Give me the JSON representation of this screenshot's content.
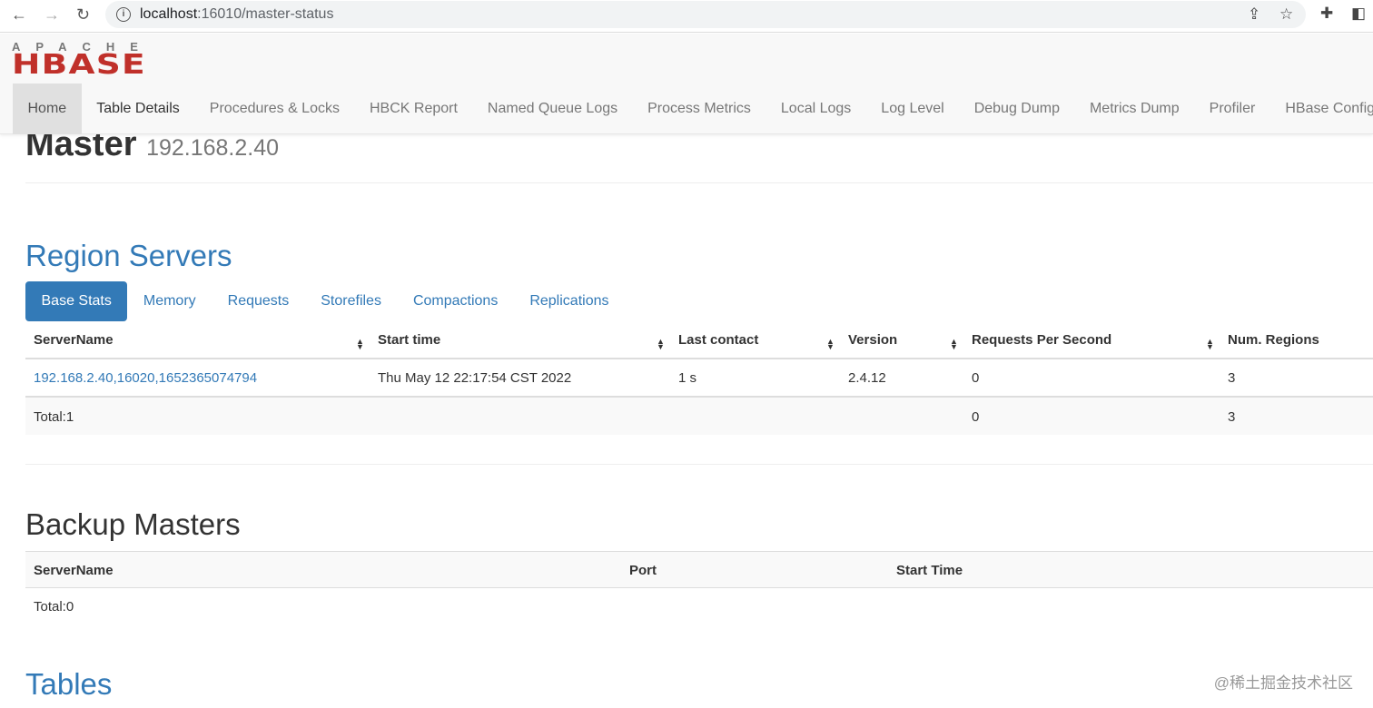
{
  "browser": {
    "url_host": "localhost",
    "url_path": ":16010/master-status"
  },
  "logo": {
    "top": "APACHE",
    "main": "HBASE"
  },
  "nav": [
    "Home",
    "Table Details",
    "Procedures & Locks",
    "HBCK Report",
    "Named Queue Logs",
    "Process Metrics",
    "Local Logs",
    "Log Level",
    "Debug Dump",
    "Metrics Dump",
    "Profiler",
    "HBase Configura"
  ],
  "master": {
    "title": "Master",
    "host": "192.168.2.40"
  },
  "region_servers": {
    "title": "Region Servers",
    "tabs": [
      "Base Stats",
      "Memory",
      "Requests",
      "Storefiles",
      "Compactions",
      "Replications"
    ],
    "columns": [
      "ServerName",
      "Start time",
      "Last contact",
      "Version",
      "Requests Per Second",
      "Num. Regions"
    ],
    "rows": [
      [
        "192.168.2.40,16020,1652365074794",
        "Thu May 12 22:17:54 CST 2022",
        "1 s",
        "2.4.12",
        "0",
        "3"
      ]
    ],
    "total": {
      "label": "Total:1",
      "rps": "0",
      "regions": "3"
    }
  },
  "backup_masters": {
    "title": "Backup Masters",
    "columns": [
      "ServerName",
      "Port",
      "Start Time"
    ],
    "total": "Total:0"
  },
  "tables": {
    "title": "Tables"
  },
  "watermark": "@稀土掘金技术社区"
}
